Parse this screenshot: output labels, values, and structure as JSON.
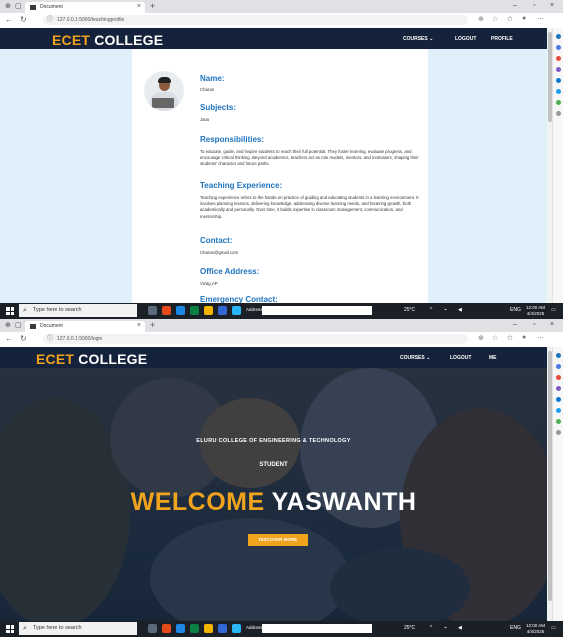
{
  "screenshot1": {
    "browser": {
      "tab_title": "Document",
      "address": "127.0.0.1:5000/teachingprofile"
    },
    "navbar": {
      "logo_part1": "ECET",
      "logo_part2": "COLLEGE",
      "menu": [
        "COURSES ⌄",
        "LOGOUT",
        "PROFILE"
      ]
    },
    "profile": {
      "sections": [
        {
          "heading": "Name:",
          "text": "Charan"
        },
        {
          "heading": "Subjects:",
          "text": "Java"
        },
        {
          "heading": "Responsibilities:",
          "text": "To educate, guide, and inspire students to reach their full potential. They foster learning, evaluate progress, and encourage critical thinking. Beyond academics, teachers act as role models, mentors, and motivators, shaping their students' character and future paths."
        },
        {
          "heading": "Teaching Experience:",
          "text": "Teaching experience refers to the hands-on practice of guiding and educating students in a learning environment. It involves planning lessons, delivering knowledge, addressing diverse learning needs, and fostering growth, both academically and personally. Over time, it builds expertise in classroom management, communication, and mentorship."
        },
        {
          "heading": "Contact:",
          "text": "Charan@gmail.com"
        },
        {
          "heading": "Office Address:",
          "text": "Vizag,AP"
        },
        {
          "heading": "Emergency Contact:",
          "text": ""
        }
      ]
    }
  },
  "screenshot2": {
    "browser": {
      "tab_title": "Document",
      "address": "127.0.0.1:5000/login"
    },
    "navbar": {
      "logo_part1": "ECET",
      "logo_part2": "COLLEGE",
      "menu": [
        "COURSES ⌄",
        "LOGOUT",
        "ME"
      ]
    },
    "hero": {
      "college_name": "ELURU COLLEGE OF ENGINEERING & TECHNOLOGY",
      "role": "STUDENT",
      "welcome_word": "WELCOME",
      "user_name": "YASWANTH",
      "button_label": "DISCOVER MORE"
    }
  },
  "taskbar": {
    "search_placeholder": "Type here to search",
    "address_label": "Address",
    "weather": "25°C",
    "language": "ENG",
    "region": "IN",
    "time": "12:00 AM",
    "date": "4/4/2025"
  },
  "colors": {
    "navbar_bg": "#14233b",
    "accent_orange": "#f0a31d",
    "heading_blue": "#1e73be",
    "page_bg": "#dff0fa"
  }
}
